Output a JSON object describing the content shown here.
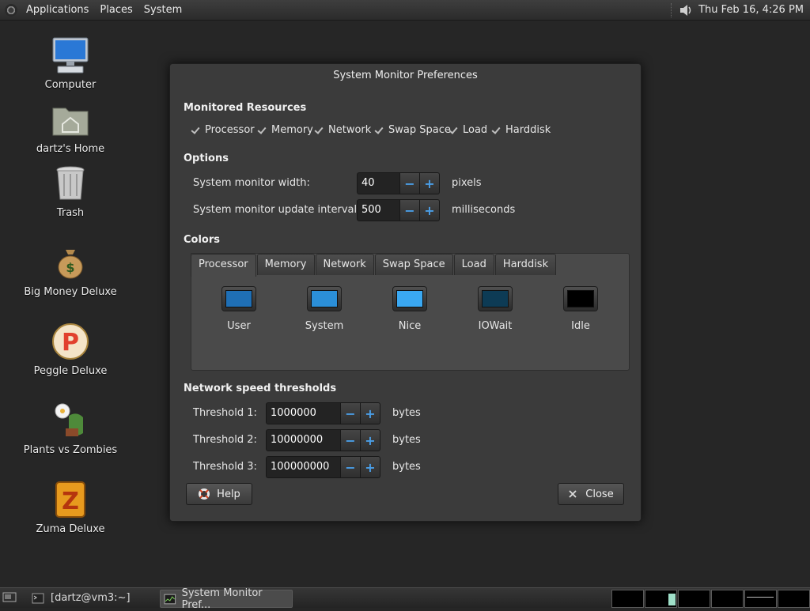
{
  "top_panel": {
    "menus": [
      "Applications",
      "Places",
      "System"
    ],
    "clock": "Thu Feb 16,  4:26 PM"
  },
  "desktop": {
    "icons": [
      {
        "label": "Computer",
        "icon": "computer-icon"
      },
      {
        "label": "dartz's Home",
        "icon": "home-folder-icon"
      },
      {
        "label": "Trash",
        "icon": "trash-icon"
      },
      {
        "label": "Big Money Deluxe",
        "icon": "money-bag-icon"
      },
      {
        "label": "Peggle Deluxe",
        "icon": "peggle-icon"
      },
      {
        "label": "Plants vs Zombies",
        "icon": "plants-vs-zombies-icon"
      },
      {
        "label": "Zuma Deluxe",
        "icon": "zuma-icon"
      }
    ]
  },
  "dialog": {
    "title": "System Monitor Preferences",
    "monitored_resources": {
      "heading": "Monitored Resources",
      "items": [
        {
          "label": "Processor",
          "checked": true
        },
        {
          "label": "Memory",
          "checked": true
        },
        {
          "label": "Network",
          "checked": true
        },
        {
          "label": "Swap Space",
          "checked": true
        },
        {
          "label": "Load",
          "checked": true
        },
        {
          "label": "Harddisk",
          "checked": true
        }
      ]
    },
    "options": {
      "heading": "Options",
      "width_label": "System monitor width:",
      "width_value": "40",
      "width_unit": "pixels",
      "interval_label": "System monitor update interval:",
      "interval_value": "500",
      "interval_unit": "milliseconds"
    },
    "colors": {
      "heading": "Colors",
      "tabs": [
        "Processor",
        "Memory",
        "Network",
        "Swap Space",
        "Load",
        "Harddisk"
      ],
      "active_tab": "Processor",
      "swatches": [
        {
          "label": "User",
          "color": "#1f6fb5"
        },
        {
          "label": "System",
          "color": "#2b8fd8"
        },
        {
          "label": "Nice",
          "color": "#3aa8f2"
        },
        {
          "label": "IOWait",
          "color": "#0d3b55"
        },
        {
          "label": "Idle",
          "color": "#000000"
        }
      ]
    },
    "network": {
      "heading": "Network speed thresholds",
      "thresholds": [
        {
          "label": "Threshold 1:",
          "value": "1000000",
          "unit": "bytes"
        },
        {
          "label": "Threshold 2:",
          "value": "10000000",
          "unit": "bytes"
        },
        {
          "label": "Threshold 3:",
          "value": "100000000",
          "unit": "bytes"
        }
      ]
    },
    "help_label": "Help",
    "close_label": "Close"
  },
  "taskbar": {
    "tasks": [
      {
        "label": "[dartz@vm3:~]",
        "active": false
      },
      {
        "label": "System Monitor Pref...",
        "active": true
      }
    ]
  },
  "colors": {
    "accent": "#4a9fe8",
    "panel": "#2b2b2b",
    "desktop": "#262626"
  }
}
